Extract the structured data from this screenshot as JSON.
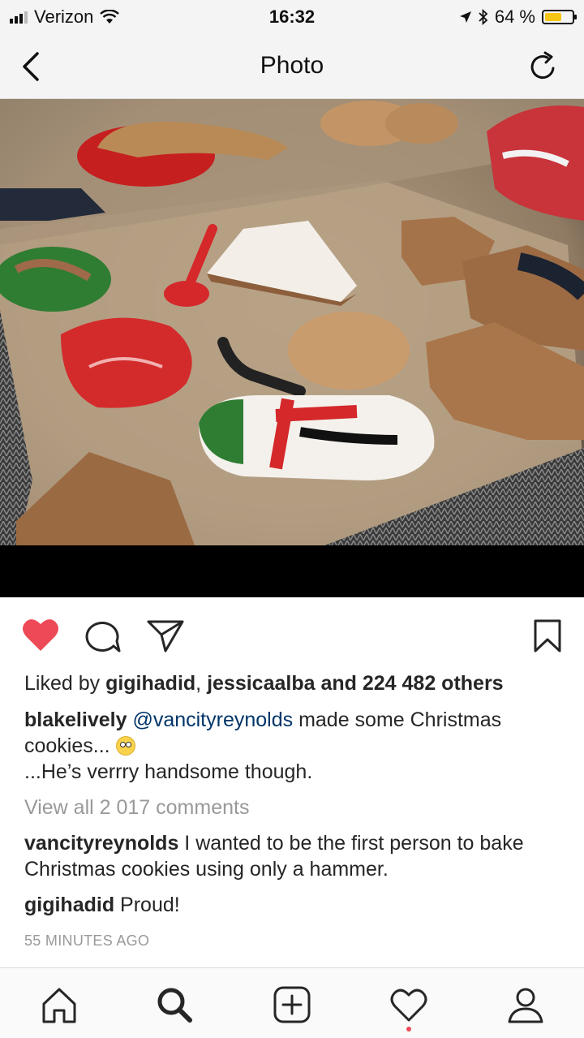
{
  "status_bar": {
    "carrier": "Verizon",
    "time": "16:32",
    "battery_text": "64 %",
    "battery_level": 0.64,
    "battery_color": "#f5c518"
  },
  "nav": {
    "title": "Photo",
    "back_icon": "chevron-left-icon",
    "refresh_icon": "refresh-icon"
  },
  "actions": {
    "liked": true,
    "like_color": "#ed4956",
    "icons": [
      "heart-icon",
      "comment-icon",
      "share-icon",
      "bookmark-icon"
    ]
  },
  "post": {
    "likes_prefix": "Liked by ",
    "likes_user1": "gigihadid",
    "likes_sep": ", ",
    "likes_user2": "jessicaalba",
    "likes_suffix": " and 224 482 others",
    "author": "blakelively",
    "mention": "@vancityreynolds",
    "caption_rest": " made some Christmas cookies... ",
    "caption_line2": "...He’s verrry handsome though.",
    "view_all": "View all 2 017 comments",
    "comments": [
      {
        "user": "vancityreynolds",
        "text": " I wanted to be the first person to bake Christmas cookies using only a hammer."
      },
      {
        "user": "gigihadid",
        "text": " Proud!"
      }
    ],
    "time_ago": "55 MINUTES AGO"
  },
  "tab_bar": {
    "tabs": [
      "home-icon",
      "search-icon",
      "add-post-icon",
      "activity-heart-icon",
      "profile-icon"
    ],
    "notification_dot_color": "#ed4956"
  }
}
